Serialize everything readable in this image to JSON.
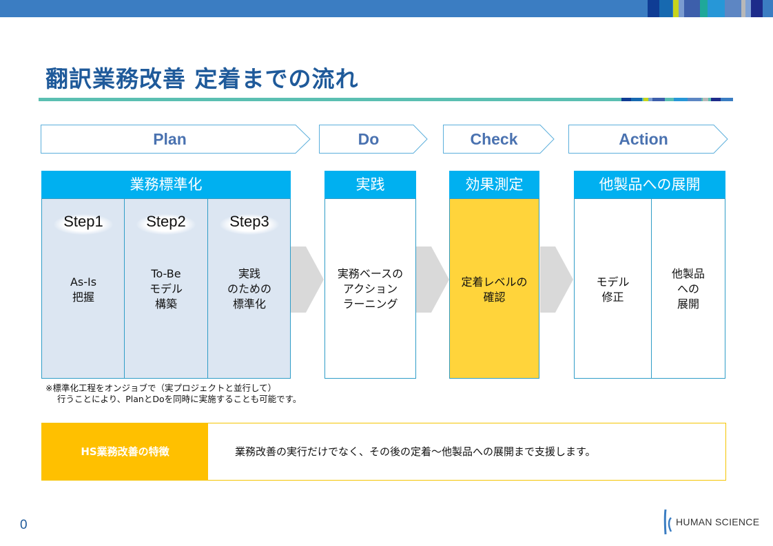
{
  "header": {
    "title": "翻訳業務改善 定着までの流れ",
    "brand_colors": {
      "topbar": "#3b7dc2",
      "title": "#1f5a9a",
      "underline": "#5bbfb2",
      "accent_blue": "#00b0f0",
      "highlight_yellow": "#ffd43b",
      "feature_orange": "#ffc000"
    }
  },
  "phases": [
    {
      "label": "Plan"
    },
    {
      "label": "Do"
    },
    {
      "label": "Check"
    },
    {
      "label": "Action"
    }
  ],
  "cards": {
    "plan": {
      "heading": "業務標準化",
      "steps": [
        {
          "step": "Step1",
          "text": [
            "As-Is",
            "把握"
          ]
        },
        {
          "step": "Step2",
          "text": [
            "To-Be",
            "モデル",
            "構築"
          ]
        },
        {
          "step": "Step3",
          "text": [
            "実践",
            "のための",
            "標準化"
          ]
        }
      ]
    },
    "do": {
      "heading": "実践",
      "text": [
        "実務ベースの",
        "アクション",
        "ラーニング"
      ]
    },
    "check": {
      "heading": "効果測定",
      "text": [
        "定着レベルの",
        "確認"
      ]
    },
    "action": {
      "heading": "他製品への展開",
      "columns": [
        {
          "text": [
            "モデル",
            "修正"
          ]
        },
        {
          "text": [
            "他製品",
            "への",
            "展開"
          ]
        }
      ]
    }
  },
  "note": {
    "line1": "※標準化工程をオンジョブで（実プロジェクトと並行して）",
    "line2": "行うことにより、PlanとDoを同時に実施することも可能です。"
  },
  "feature": {
    "label": "HS業務改善の特徴",
    "text": "業務改善の実行だけでなく、その後の定着～他製品への展開まで支援します。"
  },
  "footer": {
    "page_number": "0",
    "logo_text": "HUMAN SCIENCE"
  }
}
